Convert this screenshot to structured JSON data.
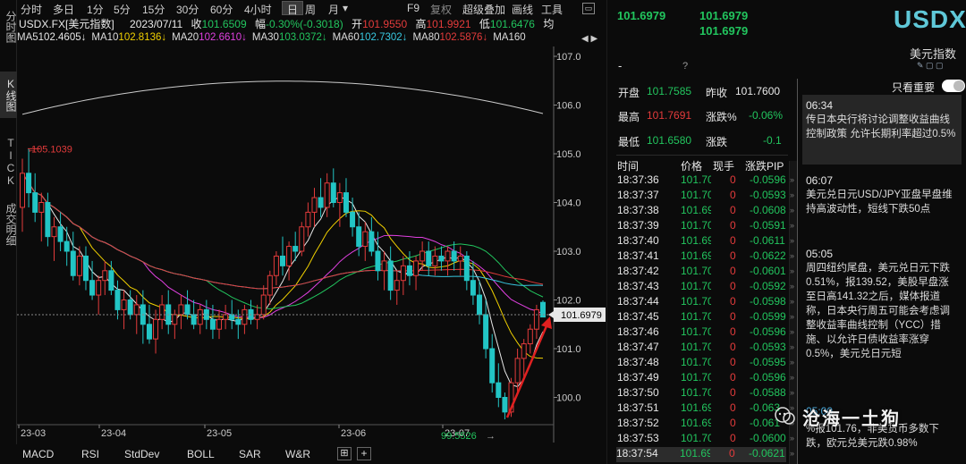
{
  "left_tabs": [
    "分时图",
    "K线图",
    "TICK",
    "成交明细"
  ],
  "toolbar": {
    "items": [
      "分时",
      "多日",
      "1分",
      "5分",
      "15分",
      "30分",
      "60分",
      "4小时",
      "日",
      "周",
      "月",
      "▾"
    ],
    "right": [
      "F9",
      "复权",
      "超级叠加",
      "画线",
      "工具"
    ]
  },
  "quote": {
    "symbol": "USDX.FX[美元指数]",
    "date": "2023/07/11",
    "close_label": "收",
    "close": "101.6509",
    "chg_label": "幅",
    "chg": "-0.30%(-0.3018)",
    "open_label": "开",
    "open": "101.9550",
    "high_label": "高",
    "high": "101.9921",
    "low_label": "低",
    "low": "101.6476",
    "avg_label": "均"
  },
  "ma": [
    {
      "label": "MA5",
      "value": "102.4605↓",
      "color": "#e8e8e8"
    },
    {
      "label": "MA10",
      "value": "102.8136↓",
      "color": "#f0d000"
    },
    {
      "label": "MA20",
      "value": "102.6610↓",
      "color": "#e040e0"
    },
    {
      "label": "MA30",
      "value": "103.0372↓",
      "color": "#22c55e"
    },
    {
      "label": "MA60",
      "value": "102.7302↓",
      "color": "#38c8e0"
    },
    {
      "label": "MA80",
      "value": "102.5876↓",
      "color": "#e33b3b"
    },
    {
      "label": "MA160",
      "value": "",
      "color": "#cccccc"
    }
  ],
  "chart_data": {
    "type": "candlestick",
    "price_axis": [
      "107.0",
      "106.0",
      "105.0",
      "104.0",
      "103.0",
      "102.0",
      "101.0",
      "100.0"
    ],
    "months": [
      "23-03",
      "23-04",
      "23-05",
      "23-06",
      "23-07"
    ],
    "current": "101.6979",
    "high_marker": "105.1039",
    "low_marker": "99.5526",
    "candles": [
      [
        103.9,
        104.9,
        103.4,
        104.6
      ],
      [
        104.6,
        105.1,
        103.9,
        104.2
      ],
      [
        104.2,
        104.6,
        103.6,
        103.8
      ],
      [
        103.8,
        104.2,
        103.2,
        104.0
      ],
      [
        104.0,
        104.2,
        103.1,
        103.3
      ],
      [
        103.3,
        103.7,
        102.8,
        103.5
      ],
      [
        103.5,
        103.8,
        103.0,
        103.2
      ],
      [
        103.2,
        103.5,
        102.7,
        103.0
      ],
      [
        103.0,
        103.4,
        102.4,
        102.5
      ],
      [
        102.5,
        103.1,
        102.3,
        102.9
      ],
      [
        102.9,
        103.1,
        102.2,
        102.4
      ],
      [
        102.4,
        102.8,
        102.0,
        102.1
      ],
      [
        102.1,
        102.5,
        101.7,
        102.4
      ],
      [
        102.4,
        102.8,
        102.1,
        102.6
      ],
      [
        102.6,
        102.8,
        102.1,
        102.2
      ],
      [
        102.2,
        102.4,
        101.6,
        101.8
      ],
      [
        101.8,
        102.2,
        101.4,
        102.0
      ],
      [
        102.0,
        102.2,
        101.6,
        101.7
      ],
      [
        101.7,
        102.1,
        101.3,
        101.9
      ],
      [
        101.9,
        102.2,
        101.1,
        101.5
      ],
      [
        101.5,
        101.9,
        101.1,
        101.2
      ],
      [
        101.2,
        101.8,
        100.9,
        101.6
      ],
      [
        101.6,
        102.1,
        101.4,
        101.9
      ],
      [
        101.9,
        102.2,
        101.3,
        101.5
      ],
      [
        101.5,
        101.8,
        101.2,
        101.7
      ],
      [
        101.7,
        102.1,
        101.4,
        101.9
      ],
      [
        101.9,
        102.2,
        101.6,
        101.7
      ],
      [
        101.7,
        102.0,
        101.4,
        101.5
      ],
      [
        101.5,
        101.9,
        101.3,
        101.8
      ],
      [
        101.8,
        102.0,
        101.4,
        101.6
      ],
      [
        101.6,
        101.9,
        101.2,
        101.4
      ],
      [
        101.4,
        101.8,
        101.2,
        101.6
      ],
      [
        101.6,
        101.9,
        101.4,
        101.7
      ],
      [
        101.7,
        102.0,
        101.4,
        101.6
      ],
      [
        101.6,
        101.8,
        101.2,
        101.5
      ],
      [
        101.5,
        101.9,
        101.3,
        101.8
      ],
      [
        101.8,
        102.0,
        101.5,
        101.6
      ],
      [
        101.6,
        101.9,
        101.4,
        101.7
      ],
      [
        101.7,
        102.3,
        101.6,
        102.1
      ],
      [
        102.1,
        102.6,
        101.9,
        102.5
      ],
      [
        102.5,
        103.0,
        102.3,
        102.9
      ],
      [
        102.9,
        103.3,
        102.5,
        102.7
      ],
      [
        102.7,
        103.2,
        102.4,
        103.1
      ],
      [
        103.1,
        103.4,
        102.8,
        103.0
      ],
      [
        103.0,
        103.6,
        102.9,
        103.5
      ],
      [
        103.5,
        104.0,
        103.3,
        103.8
      ],
      [
        103.8,
        104.3,
        103.5,
        104.1
      ],
      [
        104.1,
        104.5,
        103.7,
        103.9
      ],
      [
        103.9,
        104.6,
        103.7,
        104.4
      ],
      [
        104.4,
        104.7,
        103.9,
        104.0
      ],
      [
        104.0,
        104.4,
        103.5,
        104.2
      ],
      [
        104.2,
        104.5,
        103.7,
        103.8
      ],
      [
        103.8,
        104.1,
        103.3,
        103.5
      ],
      [
        103.5,
        103.8,
        102.9,
        103.1
      ],
      [
        103.1,
        103.6,
        102.8,
        103.4
      ],
      [
        103.4,
        103.7,
        102.9,
        103.0
      ],
      [
        103.0,
        103.4,
        102.4,
        102.6
      ],
      [
        102.6,
        103.0,
        102.2,
        102.8
      ],
      [
        102.8,
        103.1,
        102.0,
        102.2
      ],
      [
        102.2,
        102.6,
        101.9,
        102.4
      ],
      [
        102.4,
        102.9,
        102.1,
        102.7
      ],
      [
        102.7,
        103.0,
        102.3,
        102.5
      ],
      [
        102.5,
        102.9,
        102.2,
        102.8
      ],
      [
        102.8,
        103.2,
        102.6,
        103.0
      ],
      [
        103.0,
        103.2,
        102.5,
        102.7
      ],
      [
        102.7,
        103.1,
        102.5,
        102.9
      ],
      [
        102.9,
        103.1,
        102.6,
        102.8
      ],
      [
        102.8,
        103.1,
        102.5,
        103.0
      ],
      [
        103.0,
        103.2,
        102.6,
        102.8
      ],
      [
        102.8,
        103.1,
        102.5,
        102.9
      ],
      [
        102.9,
        103.0,
        102.2,
        102.4
      ],
      [
        102.4,
        102.8,
        101.9,
        102.1
      ],
      [
        102.1,
        102.4,
        101.5,
        101.7
      ],
      [
        101.7,
        102.0,
        100.8,
        101.0
      ],
      [
        101.0,
        101.3,
        100.1,
        100.3
      ],
      [
        100.3,
        100.7,
        99.8,
        100.0
      ],
      [
        100.0,
        100.1,
        99.55,
        99.7
      ],
      [
        99.7,
        100.4,
        99.6,
        100.3
      ],
      [
        100.3,
        101.0,
        100.1,
        100.8
      ],
      [
        100.8,
        101.2,
        100.4,
        101.1
      ],
      [
        101.1,
        101.5,
        100.9,
        101.4
      ],
      [
        101.4,
        101.9,
        101.2,
        101.8
      ],
      [
        101.95,
        101.99,
        101.65,
        101.65
      ]
    ]
  },
  "rp": {
    "last1": "101.6979",
    "last2": "101.6979",
    "last3": "101.6979",
    "title": "USDX",
    "subtitle": "美元指数",
    "dash": "-",
    "q": "?",
    "open_label": "开盘",
    "open": "101.7585",
    "prev_label": "昨收",
    "prev": "101.7600",
    "high_label": "最高",
    "high": "101.7691",
    "pct_label": "涨跌%",
    "pct": "-0.06%",
    "low_label": "最低",
    "low": "101.6580",
    "chg_label": "涨跌",
    "chg": "-0.1",
    "only_label": "只看重要",
    "headers": [
      "时间",
      "价格",
      "现手",
      "涨跌PIP"
    ],
    "ticks": [
      [
        "18:37:36",
        "101.70",
        "0",
        "-0.0596"
      ],
      [
        "18:37:37",
        "101.70",
        "0",
        "-0.0593"
      ],
      [
        "18:37:38",
        "101.69",
        "0",
        "-0.0608"
      ],
      [
        "18:37:39",
        "101.70",
        "0",
        "-0.0591"
      ],
      [
        "18:37:40",
        "101.69",
        "0",
        "-0.0611"
      ],
      [
        "18:37:41",
        "101.69",
        "0",
        "-0.0622"
      ],
      [
        "18:37:42",
        "101.70",
        "0",
        "-0.0601"
      ],
      [
        "18:37:43",
        "101.70",
        "0",
        "-0.0592"
      ],
      [
        "18:37:44",
        "101.70",
        "0",
        "-0.0598"
      ],
      [
        "18:37:45",
        "101.70",
        "0",
        "-0.0599"
      ],
      [
        "18:37:46",
        "101.70",
        "0",
        "-0.0596"
      ],
      [
        "18:37:47",
        "101.70",
        "0",
        "-0.0593"
      ],
      [
        "18:37:48",
        "101.70",
        "0",
        "-0.0595"
      ],
      [
        "18:37:49",
        "101.70",
        "0",
        "-0.0596"
      ],
      [
        "18:37:50",
        "101.70",
        "0",
        "-0.0588"
      ],
      [
        "18:37:51",
        "101.69",
        "0",
        "-0.063"
      ],
      [
        "18:37:52",
        "101.69",
        "0",
        "-0.061"
      ],
      [
        "18:37:53",
        "101.70",
        "0",
        "-0.0600"
      ],
      [
        "18:37:54",
        "101.69",
        "0",
        "-0.0621"
      ]
    ],
    "news": [
      {
        "time": "06:34",
        "text": "传日本央行将讨论调整收益曲线控制政策 允许长期利率超过0.5%"
      },
      {
        "time": "06:07",
        "text": "美元兑日元USD/JPY亚盘早盘维持高波动性，短线下跌50点"
      },
      {
        "time": "05:05",
        "text": "周四纽约尾盘，美元兑日元下跌0.51%，报139.52，美股早盘涨至日高141.32之后，媒体报道称，日本央行周五可能会考虑调整收益率曲线控制（YCC）措施、以允许日债收益率涨穿0.5%，美元兑日元短"
      },
      {
        "time": "05:00",
        "text": "%报101.76，非美货币多数下跌，欧元兑美元跌0.98%"
      }
    ],
    "watermark": "沧海一土狗"
  },
  "bottom_tabs": [
    "MACD",
    "RSI",
    "StdDev",
    "BOLL",
    "SAR",
    "W&R",
    "⊞",
    "+"
  ]
}
